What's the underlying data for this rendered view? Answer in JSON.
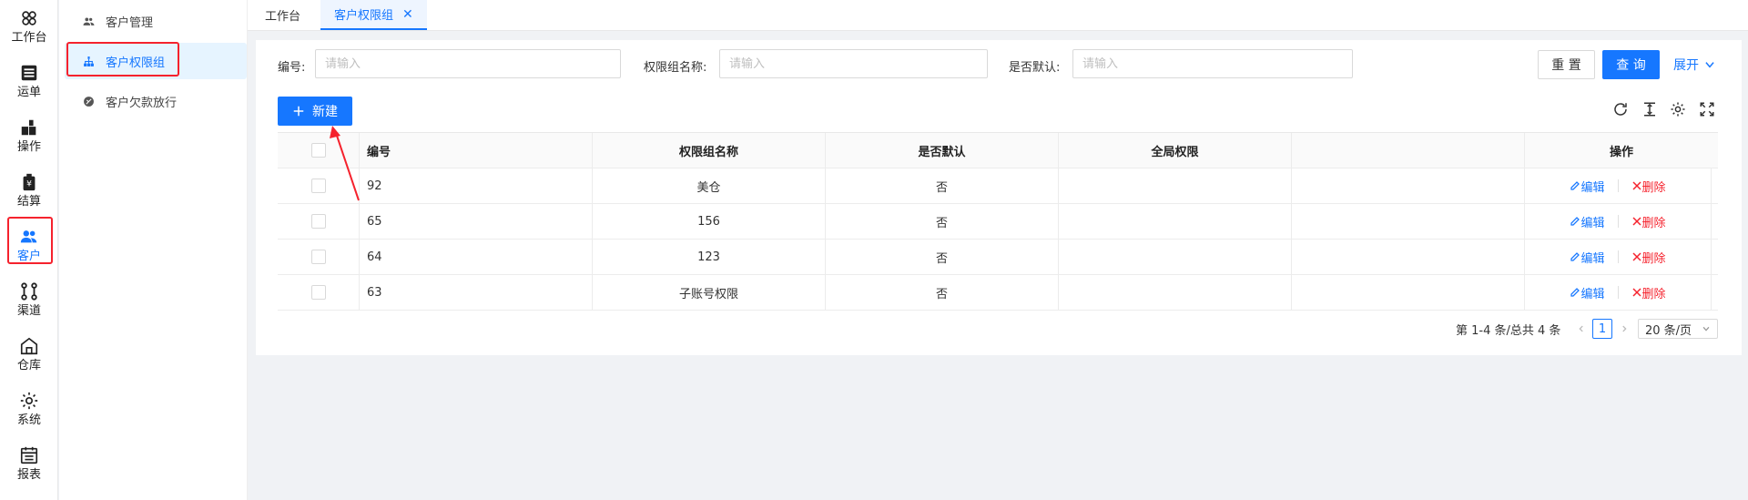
{
  "rail": [
    {
      "label": "工作台",
      "icon": "workbench-icon"
    },
    {
      "label": "运单",
      "icon": "waybill-icon"
    },
    {
      "label": "操作",
      "icon": "operation-icon"
    },
    {
      "label": "结算",
      "icon": "settlement-icon"
    },
    {
      "label": "客户",
      "icon": "customer-icon",
      "active": true
    },
    {
      "label": "渠道",
      "icon": "channel-icon"
    },
    {
      "label": "仓库",
      "icon": "warehouse-icon"
    },
    {
      "label": "系统",
      "icon": "gear-icon"
    },
    {
      "label": "报表",
      "icon": "report-icon"
    }
  ],
  "subnav": [
    {
      "label": "客户管理",
      "icon": "users-icon"
    },
    {
      "label": "客户权限组",
      "icon": "org-tree-icon",
      "active": true
    },
    {
      "label": "客户欠款放行",
      "icon": "release-icon"
    }
  ],
  "tabs": [
    {
      "label": "工作台"
    },
    {
      "label": "客户权限组",
      "active": true,
      "close": "✕"
    }
  ],
  "filters": {
    "code_label": "编号:",
    "code_placeholder": "请输入",
    "name_label": "权限组名称:",
    "name_placeholder": "请输入",
    "default_label": "是否默认:",
    "default_placeholder": "请输入"
  },
  "actions": {
    "reset": "重 置",
    "query": "查 询",
    "expand": "展开",
    "new": "新建"
  },
  "table": {
    "headers": [
      "编号",
      "权限组名称",
      "是否默认",
      "全局权限",
      "",
      "操作"
    ],
    "rows": [
      {
        "code": "92",
        "name": "美仓",
        "default": "否",
        "global": "",
        "extra": ""
      },
      {
        "code": "65",
        "name": "156",
        "default": "否",
        "global": "",
        "extra": ""
      },
      {
        "code": "64",
        "name": "123",
        "default": "否",
        "global": "",
        "extra": ""
      },
      {
        "code": "63",
        "name": "子账号权限",
        "default": "否",
        "global": "",
        "extra": ""
      }
    ],
    "edit_label": "编辑",
    "delete_label": "删除"
  },
  "pagination": {
    "summary": "第 1-4 条/总共 4 条",
    "current_page": "1",
    "page_size": "20 条/页"
  },
  "colors": {
    "primary": "#1677ff",
    "danger": "#f5222d",
    "highlight": "#f5222d"
  }
}
